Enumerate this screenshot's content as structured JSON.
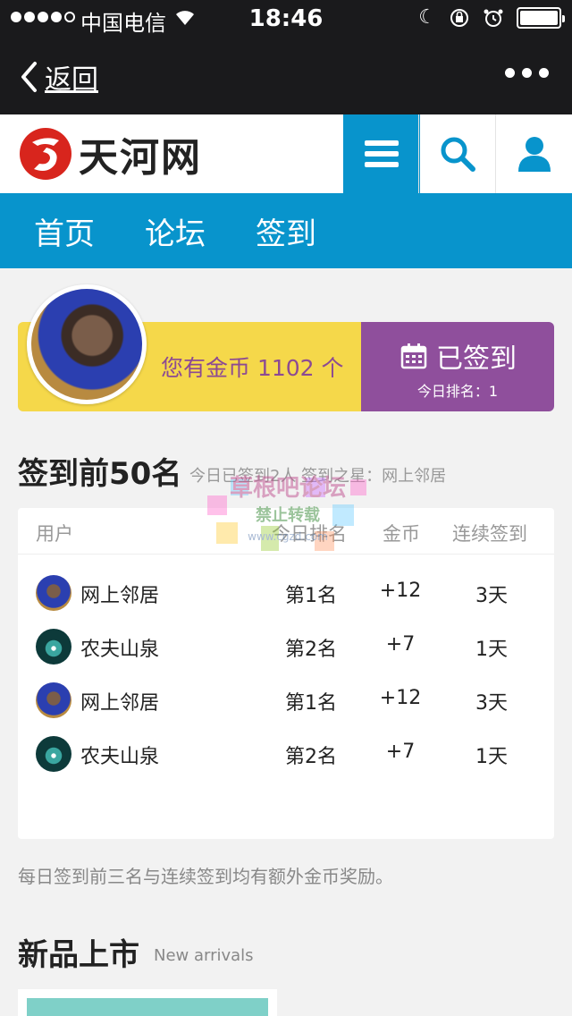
{
  "status_bar": {
    "carrier": "中国电信",
    "time": "18:46"
  },
  "navbar": {
    "back_label": "返回"
  },
  "site": {
    "logo_text": "天河网"
  },
  "main_nav": [
    {
      "label": "首页"
    },
    {
      "label": "论坛"
    },
    {
      "label": "签到"
    }
  ],
  "checkin": {
    "coins_text": "您有金币 1102 个",
    "signed_label": "已签到",
    "rank_today": "今日排名：1"
  },
  "top50": {
    "title": "签到前50名",
    "subtitle": "今日已签到2人    签到之星：网上邻居",
    "columns": [
      "用户",
      "今日排名",
      "金币",
      "连续签到"
    ],
    "rows": [
      {
        "name": "网上邻居",
        "rank": "第1名",
        "coins": "+12",
        "streak": "3天"
      },
      {
        "name": "农夫山泉",
        "rank": "第2名",
        "coins": "+7",
        "streak": "1天"
      },
      {
        "name": "网上邻居",
        "rank": "第1名",
        "coins": "+12",
        "streak": "3天"
      },
      {
        "name": "农夫山泉",
        "rank": "第2名",
        "coins": "+7",
        "streak": "1天"
      }
    ],
    "note": "每日签到前三名与连续签到均有额外金币奖励。"
  },
  "watermark": {
    "line1": "草根吧论坛",
    "line2": "禁止转载",
    "line3": "www.cgzd.com"
  },
  "new_arrivals": {
    "title": "新品上市",
    "subtitle": "New arrivals"
  },
  "colors": {
    "accent_blue": "#0894cc",
    "banner_yellow": "#f5d84a",
    "banner_purple": "#8f4f9c"
  }
}
